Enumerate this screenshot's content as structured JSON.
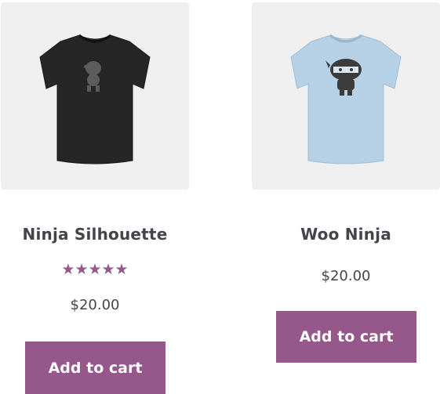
{
  "products": [
    {
      "title": "Ninja Silhouette",
      "rating_stars": "★★★★★",
      "rating_value": 5,
      "price": "$20.00",
      "button_label": "Add to cart",
      "shirt_color": "#2a2a2a"
    },
    {
      "title": "Woo Ninja",
      "price": "$20.00",
      "button_label": "Add to cart",
      "shirt_color": "#b6d1e6"
    }
  ],
  "colors": {
    "accent": "#96588a",
    "card_bg": "#efeff0",
    "text": "#43454b"
  }
}
